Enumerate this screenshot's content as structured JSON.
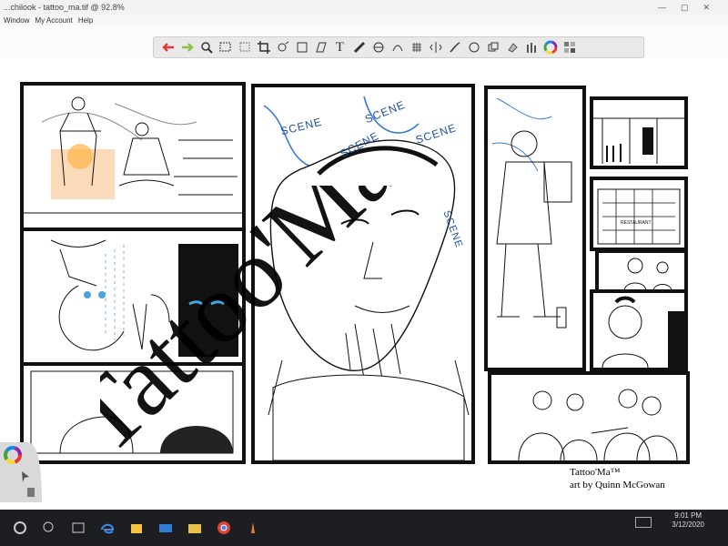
{
  "window": {
    "title": "...chilook - tattoo_ma.tif @ 92.8%",
    "controls": [
      "—",
      "▢",
      "✕"
    ]
  },
  "menu": {
    "items": [
      "Window",
      "My Account",
      "Help"
    ]
  },
  "toolbar": {
    "tools": [
      "undo-icon",
      "redo-icon",
      "zoom-icon",
      "selection-icon",
      "lasso-icon",
      "crop-icon",
      "transform-icon",
      "distort-icon",
      "warp-icon",
      "text-icon",
      "ruler-icon",
      "ellipse-guide-icon",
      "perspective-icon",
      "grid-icon",
      "symmetry-icon",
      "stroke-icon",
      "shape-icon",
      "layer-icon",
      "fill-icon",
      "brush-icon",
      "color-wheel-icon",
      "swatches-icon"
    ],
    "colors": {
      "color_wheel": [
        "#e53935",
        "#fdd835",
        "#43a047",
        "#1e88e5",
        "#8e24aa"
      ]
    }
  },
  "comic": {
    "scene_labels": [
      "SCENE",
      "SCENE",
      "SCENE",
      "SCENE",
      "SCENE"
    ],
    "storefront_sign": "RESTAURANT"
  },
  "watermark": {
    "text": "Tattoo'Ma"
  },
  "credit": {
    "line1": "Tattoo'Ma™",
    "line2": "art by Quinn McGowan"
  },
  "taskbar": {
    "icons": [
      "windows-start-icon",
      "search-icon",
      "task-view-icon",
      "edge-browser-icon",
      "store-icon",
      "mail-icon",
      "file-explorer-icon",
      "chrome-icon",
      "app-icon"
    ],
    "time": "9:01 PM",
    "date": "3/12/2020"
  }
}
